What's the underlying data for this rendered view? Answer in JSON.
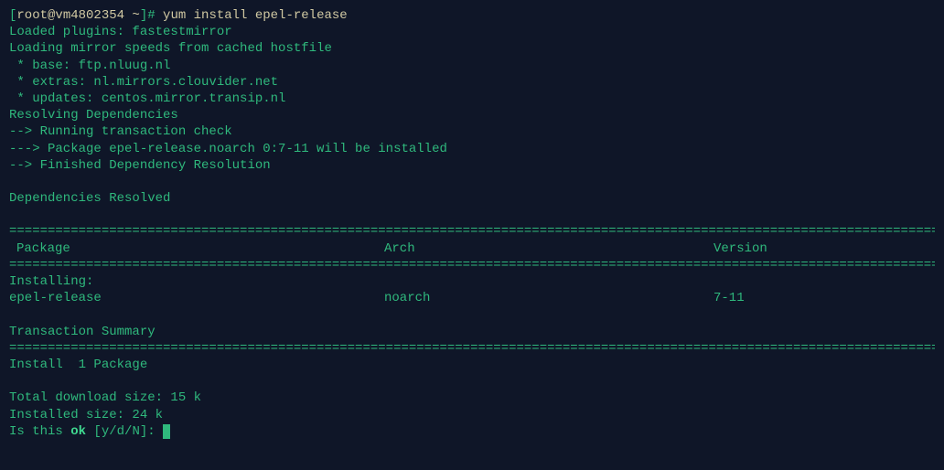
{
  "prompt": {
    "open": "[",
    "user_host": "root@vm4802354 ~",
    "close": "]#",
    "command": "yum install epel-release"
  },
  "output": {
    "plugins": "Loaded plugins: fastestmirror",
    "loading": "Loading mirror speeds from cached hostfile",
    "mirror_base": " * base: ftp.nluug.nl",
    "mirror_extras": " * extras: nl.mirrors.clouvider.net",
    "mirror_updates": " * updates: centos.mirror.transip.nl",
    "resolving": "Resolving Dependencies",
    "running_check": "--> Running transaction check",
    "package_line": "---> Package epel-release.noarch 0:7-11 will be installed",
    "finished": "--> Finished Dependency Resolution",
    "deps_resolved": "Dependencies Resolved"
  },
  "table": {
    "header": {
      "package": "Package",
      "arch": "Arch",
      "version": "Version"
    },
    "installing_label": "Installing:",
    "row": {
      "package": " epel-release",
      "arch": "noarch",
      "version": "7-11"
    }
  },
  "summary": {
    "title": "Transaction Summary",
    "install": "Install  1 Package",
    "download_size": "Total download size: 15 k",
    "installed_size": "Installed size: 24 k",
    "confirm_prefix": "Is this ",
    "confirm_ok": "ok",
    "confirm_suffix": " [y/d/N]: "
  },
  "hr": "==========================================================================================================================================="
}
